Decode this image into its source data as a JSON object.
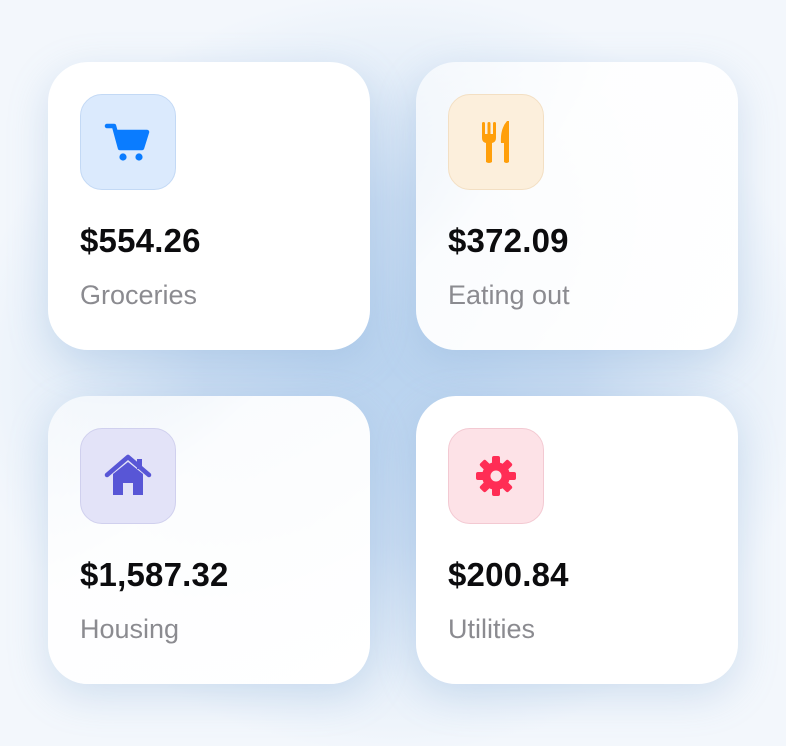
{
  "categories": [
    {
      "label": "Groceries",
      "amount": "$554.26",
      "icon": "cart-icon",
      "icon_color": "#0a7cff",
      "tile_color": "#dbeafd",
      "tile_border": "#c3d9f5"
    },
    {
      "label": "Eating out",
      "amount": "$372.09",
      "icon": "fork-knife-icon",
      "icon_color": "#ff9f0a",
      "tile_color": "#fcefdc",
      "tile_border": "#f3dfc3"
    },
    {
      "label": "Housing",
      "amount": "$1,587.32",
      "icon": "house-icon",
      "icon_color": "#5856d6",
      "tile_color": "#e3e3f8",
      "tile_border": "#d0d0ee"
    },
    {
      "label": "Utilities",
      "amount": "$200.84",
      "icon": "gear-icon",
      "icon_color": "#ff2d55",
      "tile_color": "#fde2e7",
      "tile_border": "#f3c9d2"
    }
  ]
}
